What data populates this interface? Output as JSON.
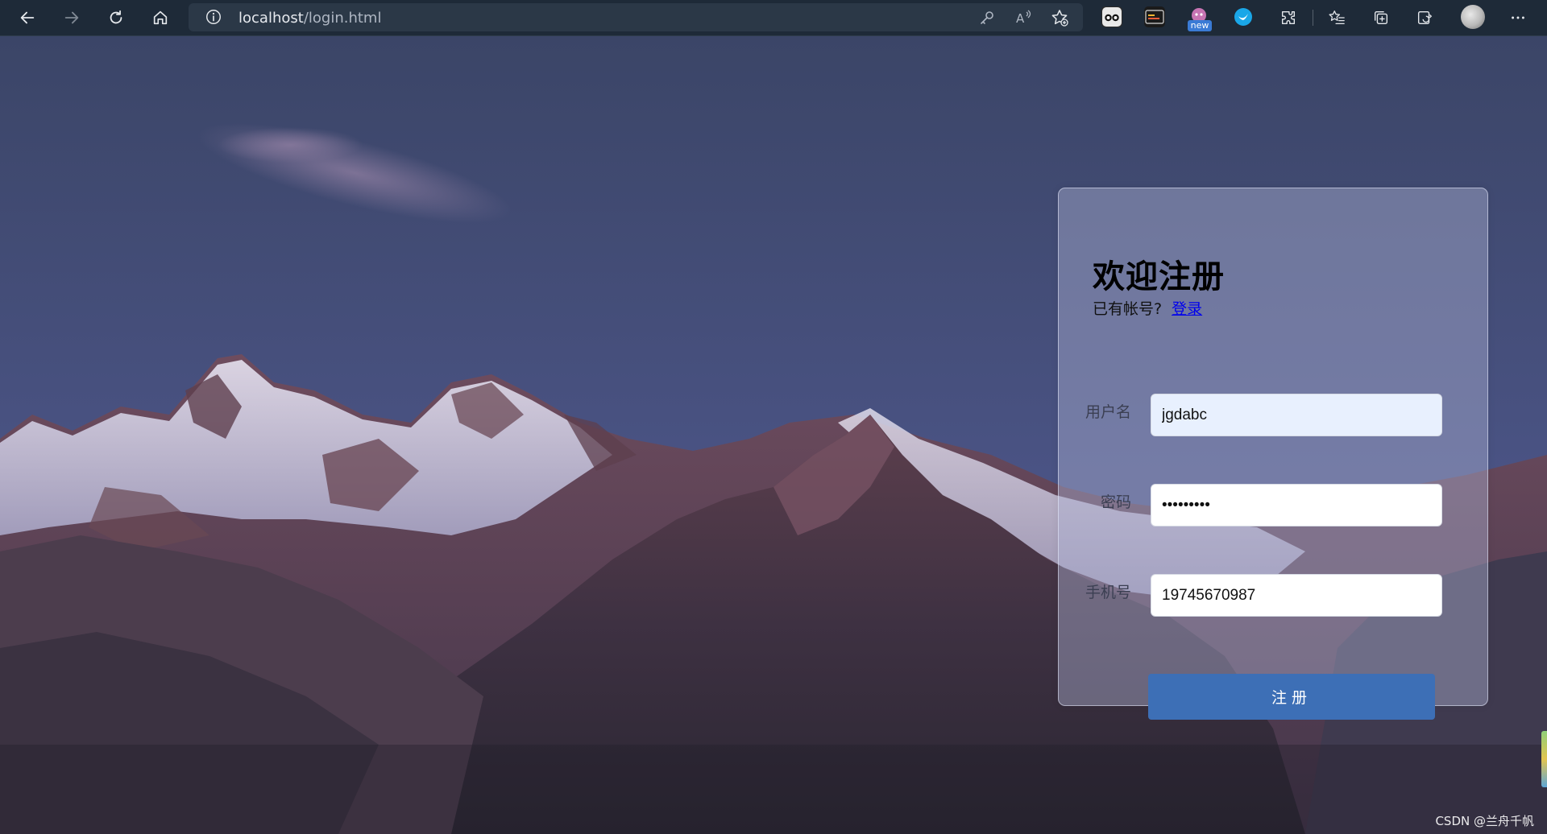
{
  "browser": {
    "url_host": "localhost",
    "url_path": "/login.html",
    "extensions": [
      {
        "icon": "cheat-glasses-icon",
        "color": "#2b2b2b"
      },
      {
        "icon": "terminal-icon",
        "color": "#1b1b1b"
      },
      {
        "icon": "mascot-icon",
        "color": "#c774b3",
        "badge": "new"
      },
      {
        "icon": "bird-icon",
        "color": "#1aa7e8"
      }
    ]
  },
  "form": {
    "title": "欢迎注册",
    "hint_text": "已有帐号?",
    "login_link": "登录",
    "username_label": "用户名",
    "username_value": "jgdabc",
    "password_label": "密码",
    "password_value": "jgdabc123",
    "phone_label": "手机号",
    "phone_value": "19745670987",
    "submit_label": "注册"
  },
  "watermark": "CSDN @兰舟千帆",
  "colors": {
    "button": "#3d6fb6",
    "autofill": "#e8f0fe",
    "link": "#0000ee"
  }
}
